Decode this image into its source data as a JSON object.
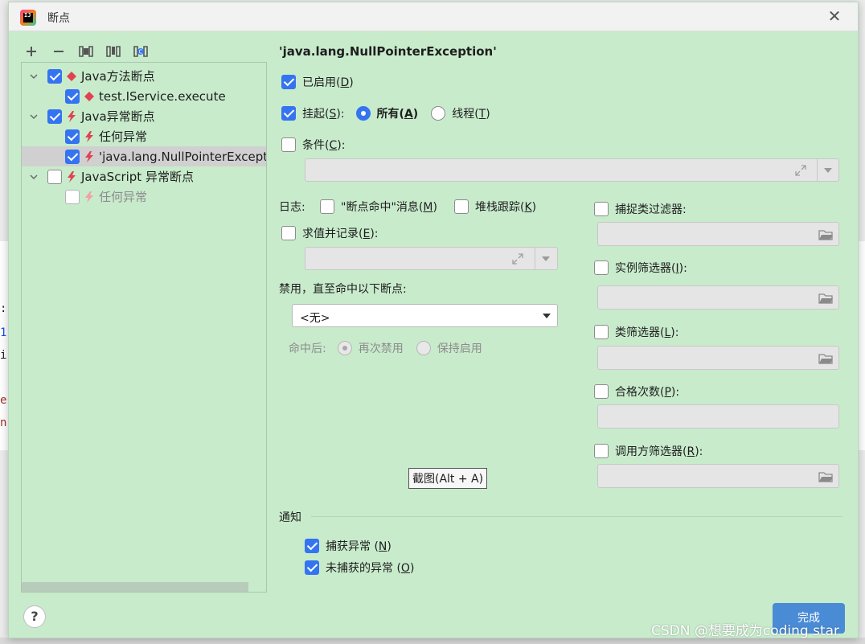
{
  "window": {
    "title": "断点",
    "app_icon": "intellij-icon"
  },
  "toolbar": {
    "buttons": [
      "add-icon",
      "remove-icon",
      "group-by-file-icon",
      "group-by-package-icon",
      "group-by-class-icon"
    ]
  },
  "tree": {
    "items": [
      {
        "label": "Java方法断点",
        "checked": true,
        "icon": "method-breakpoint-icon"
      },
      {
        "label": "test.IService.execute",
        "checked": true,
        "icon": "method-breakpoint-icon"
      },
      {
        "label": "Java异常断点",
        "checked": true,
        "icon": "exception-breakpoint-icon"
      },
      {
        "label": "任何异常",
        "checked": true,
        "icon": "exception-breakpoint-icon"
      },
      {
        "label": "'java.lang.NullPointerExceptio",
        "checked": true,
        "icon": "exception-breakpoint-icon"
      },
      {
        "label": "JavaScript 异常断点",
        "checked": false,
        "icon": "exception-breakpoint-icon"
      },
      {
        "label": "任何异常",
        "checked": false,
        "icon": "exception-breakpoint-icon"
      }
    ]
  },
  "detail": {
    "heading": "'java.lang.NullPointerException'",
    "enabled_label": "已启用(",
    "enabled_key": "D",
    "suspend_label": "挂起(",
    "suspend_key": "S",
    "suspend_all": "所有(",
    "suspend_all_key": "A",
    "suspend_thread": "线程(",
    "suspend_thread_key": "T",
    "condition_label": "条件(",
    "condition_key": "C",
    "log_label": "日志:",
    "log_msg_label": "\"断点命中\"消息(",
    "log_msg_key": "M",
    "stack_trace_label": "堆栈跟踪(",
    "stack_trace_key": "K",
    "evaluate_label": "求值并记录(",
    "evaluate_key": "E",
    "disable_until_label": "禁用，直至命中以下断点:",
    "disable_until_value": "<无>",
    "after_hit_label": "命中后:",
    "after_hit_disable": "再次禁用",
    "after_hit_keep": "保持启用",
    "catch_class_filter": "捕捉类过滤器:",
    "instance_filter": "实例筛选器(",
    "instance_filter_key": "I",
    "class_filter": "类筛选器(",
    "class_filter_key": "L",
    "pass_count": "合格次数(",
    "pass_count_key": "P",
    "caller_filter": "调用方筛选器(",
    "caller_filter_key": "R",
    "tooltip": "截图(Alt + A)",
    "notify_label": "通知",
    "caught_label": "捕获异常 (",
    "caught_key": "N",
    "uncaught_label": "未捕获的异常 (",
    "uncaught_key": "O"
  },
  "footer": {
    "help": "?",
    "done": "完成"
  },
  "watermark": "CSDN @想要成为coding star",
  "background": {
    "chars": [
      ":",
      "1",
      "i",
      "e",
      "n"
    ]
  },
  "colors": {
    "dialog_bg": "#c8ebcc",
    "accent": "#3574f0",
    "done": "#4a8bd6",
    "method_icon": "#e0434f",
    "exception_icon": "#e0434f"
  }
}
